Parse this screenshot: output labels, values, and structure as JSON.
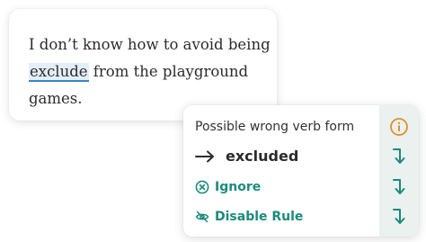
{
  "text": {
    "line1": "I don’t know how to avoid being",
    "error_word": "exclude",
    "line2_rest": " from the playground",
    "line3": "games."
  },
  "suggestion_panel": {
    "title": "Possible wrong verb form",
    "suggestion": "excluded",
    "ignore_label": "Ignore",
    "disable_label": "Disable Rule"
  },
  "icons": {
    "info": "info-icon",
    "arrow": "arrow-right-icon",
    "ignore": "close-circle-icon",
    "disable": "eye-off-icon",
    "apply": "turn-down-arrow-icon"
  },
  "colors": {
    "accent_teal": "#1c8a7c",
    "info_orange": "#e0902b",
    "error_highlight": "#e3eef8",
    "error_underline": "#3a84c4"
  }
}
